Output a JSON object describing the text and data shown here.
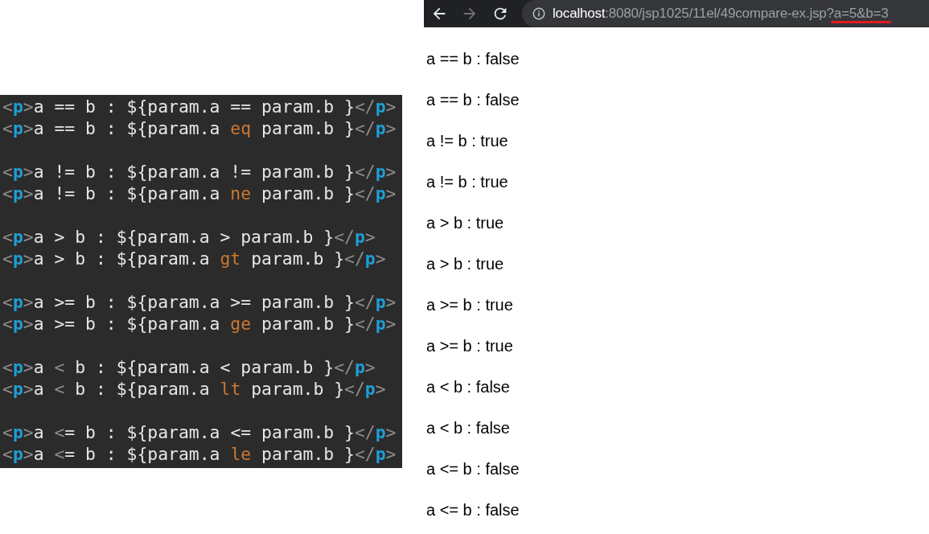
{
  "code_editor": {
    "groups": [
      {
        "lines": [
          [
            {
              "kind": "punct",
              "text": "<"
            },
            {
              "kind": "tag",
              "text": "p"
            },
            {
              "kind": "punct",
              "text": ">"
            },
            {
              "kind": "text",
              "text": "a == b : ${param.a == param.b }"
            },
            {
              "kind": "punct",
              "text": "</"
            },
            {
              "kind": "tag",
              "text": "p"
            },
            {
              "kind": "punct",
              "text": ">"
            }
          ],
          [
            {
              "kind": "punct",
              "text": "<"
            },
            {
              "kind": "tag",
              "text": "p"
            },
            {
              "kind": "punct",
              "text": ">"
            },
            {
              "kind": "text",
              "text": "a == b : ${param.a "
            },
            {
              "kind": "keyword",
              "text": "eq"
            },
            {
              "kind": "text",
              "text": " param.b }"
            },
            {
              "kind": "punct",
              "text": "</"
            },
            {
              "kind": "tag",
              "text": "p"
            },
            {
              "kind": "punct",
              "text": ">"
            }
          ]
        ]
      },
      {
        "lines": [
          [
            {
              "kind": "punct",
              "text": "<"
            },
            {
              "kind": "tag",
              "text": "p"
            },
            {
              "kind": "punct",
              "text": ">"
            },
            {
              "kind": "text",
              "text": "a != b : ${param.a != param.b }"
            },
            {
              "kind": "punct",
              "text": "</"
            },
            {
              "kind": "tag",
              "text": "p"
            },
            {
              "kind": "punct",
              "text": ">"
            }
          ],
          [
            {
              "kind": "punct",
              "text": "<"
            },
            {
              "kind": "tag",
              "text": "p"
            },
            {
              "kind": "punct",
              "text": ">"
            },
            {
              "kind": "text",
              "text": "a != b : ${param.a "
            },
            {
              "kind": "keyword",
              "text": "ne"
            },
            {
              "kind": "text",
              "text": " param.b }"
            },
            {
              "kind": "punct",
              "text": "</"
            },
            {
              "kind": "tag",
              "text": "p"
            },
            {
              "kind": "punct",
              "text": ">"
            }
          ]
        ]
      },
      {
        "lines": [
          [
            {
              "kind": "punct",
              "text": "<"
            },
            {
              "kind": "tag",
              "text": "p"
            },
            {
              "kind": "punct",
              "text": ">"
            },
            {
              "kind": "text",
              "text": "a > b : ${param.a > param.b }"
            },
            {
              "kind": "punct",
              "text": "</"
            },
            {
              "kind": "tag",
              "text": "p"
            },
            {
              "kind": "punct",
              "text": ">"
            }
          ],
          [
            {
              "kind": "punct",
              "text": "<"
            },
            {
              "kind": "tag",
              "text": "p"
            },
            {
              "kind": "punct",
              "text": ">"
            },
            {
              "kind": "text",
              "text": "a > b : ${param.a "
            },
            {
              "kind": "keyword",
              "text": "gt"
            },
            {
              "kind": "text",
              "text": " param.b }"
            },
            {
              "kind": "punct",
              "text": "</"
            },
            {
              "kind": "tag",
              "text": "p"
            },
            {
              "kind": "punct",
              "text": ">"
            }
          ]
        ]
      },
      {
        "lines": [
          [
            {
              "kind": "punct",
              "text": "<"
            },
            {
              "kind": "tag",
              "text": "p"
            },
            {
              "kind": "punct",
              "text": ">"
            },
            {
              "kind": "text",
              "text": "a >= b : ${param.a >= param.b }"
            },
            {
              "kind": "punct",
              "text": "</"
            },
            {
              "kind": "tag",
              "text": "p"
            },
            {
              "kind": "punct",
              "text": ">"
            }
          ],
          [
            {
              "kind": "punct",
              "text": "<"
            },
            {
              "kind": "tag",
              "text": "p"
            },
            {
              "kind": "punct",
              "text": ">"
            },
            {
              "kind": "text",
              "text": "a >= b : ${param.a "
            },
            {
              "kind": "keyword",
              "text": "ge"
            },
            {
              "kind": "text",
              "text": " param.b }"
            },
            {
              "kind": "punct",
              "text": "</"
            },
            {
              "kind": "tag",
              "text": "p"
            },
            {
              "kind": "punct",
              "text": ">"
            }
          ]
        ]
      },
      {
        "lines": [
          [
            {
              "kind": "punct",
              "text": "<"
            },
            {
              "kind": "tag",
              "text": "p"
            },
            {
              "kind": "punct",
              "text": ">"
            },
            {
              "kind": "text",
              "text": "a "
            },
            {
              "kind": "entity",
              "text": "<"
            },
            {
              "kind": "text",
              "text": " b : ${param.a < param.b }"
            },
            {
              "kind": "punct",
              "text": "</"
            },
            {
              "kind": "tag",
              "text": "p"
            },
            {
              "kind": "punct",
              "text": ">"
            }
          ],
          [
            {
              "kind": "punct",
              "text": "<"
            },
            {
              "kind": "tag",
              "text": "p"
            },
            {
              "kind": "punct",
              "text": ">"
            },
            {
              "kind": "text",
              "text": "a "
            },
            {
              "kind": "entity",
              "text": "<"
            },
            {
              "kind": "text",
              "text": " b : ${param.a "
            },
            {
              "kind": "keyword",
              "text": "lt"
            },
            {
              "kind": "text",
              "text": " param.b }"
            },
            {
              "kind": "punct",
              "text": "</"
            },
            {
              "kind": "tag",
              "text": "p"
            },
            {
              "kind": "punct",
              "text": ">"
            }
          ]
        ]
      },
      {
        "lines": [
          [
            {
              "kind": "punct",
              "text": "<"
            },
            {
              "kind": "tag",
              "text": "p"
            },
            {
              "kind": "punct",
              "text": ">"
            },
            {
              "kind": "text",
              "text": "a "
            },
            {
              "kind": "entity",
              "text": "<"
            },
            {
              "kind": "text",
              "text": "= b : ${param.a <= param.b }"
            },
            {
              "kind": "punct",
              "text": "</"
            },
            {
              "kind": "tag",
              "text": "p"
            },
            {
              "kind": "punct",
              "text": ">"
            }
          ],
          [
            {
              "kind": "punct",
              "text": "<"
            },
            {
              "kind": "tag",
              "text": "p"
            },
            {
              "kind": "punct",
              "text": ">"
            },
            {
              "kind": "text",
              "text": "a "
            },
            {
              "kind": "entity",
              "text": "<"
            },
            {
              "kind": "text",
              "text": "= b : ${param.a "
            },
            {
              "kind": "keyword",
              "text": "le"
            },
            {
              "kind": "text",
              "text": " param.b }"
            },
            {
              "kind": "punct",
              "text": "</"
            },
            {
              "kind": "tag",
              "text": "p"
            },
            {
              "kind": "punct",
              "text": ">"
            }
          ]
        ]
      }
    ]
  },
  "browser": {
    "address_bar": [
      {
        "kind": "host",
        "text": "localhost"
      },
      {
        "kind": "path",
        "text": ":8080/jsp1025/11el/49compare-ex.jsp?"
      },
      {
        "kind": "query",
        "text": "a=5&b=3"
      }
    ],
    "forward_disabled": true,
    "output_lines": [
      "a == b : false",
      "a == b : false",
      "a != b : true",
      "a != b : true",
      "a > b : true",
      "a > b : true",
      "a >= b : true",
      "a >= b : true",
      "a < b : false",
      "a < b : false",
      "a <= b : false",
      "a <= b : false"
    ]
  }
}
